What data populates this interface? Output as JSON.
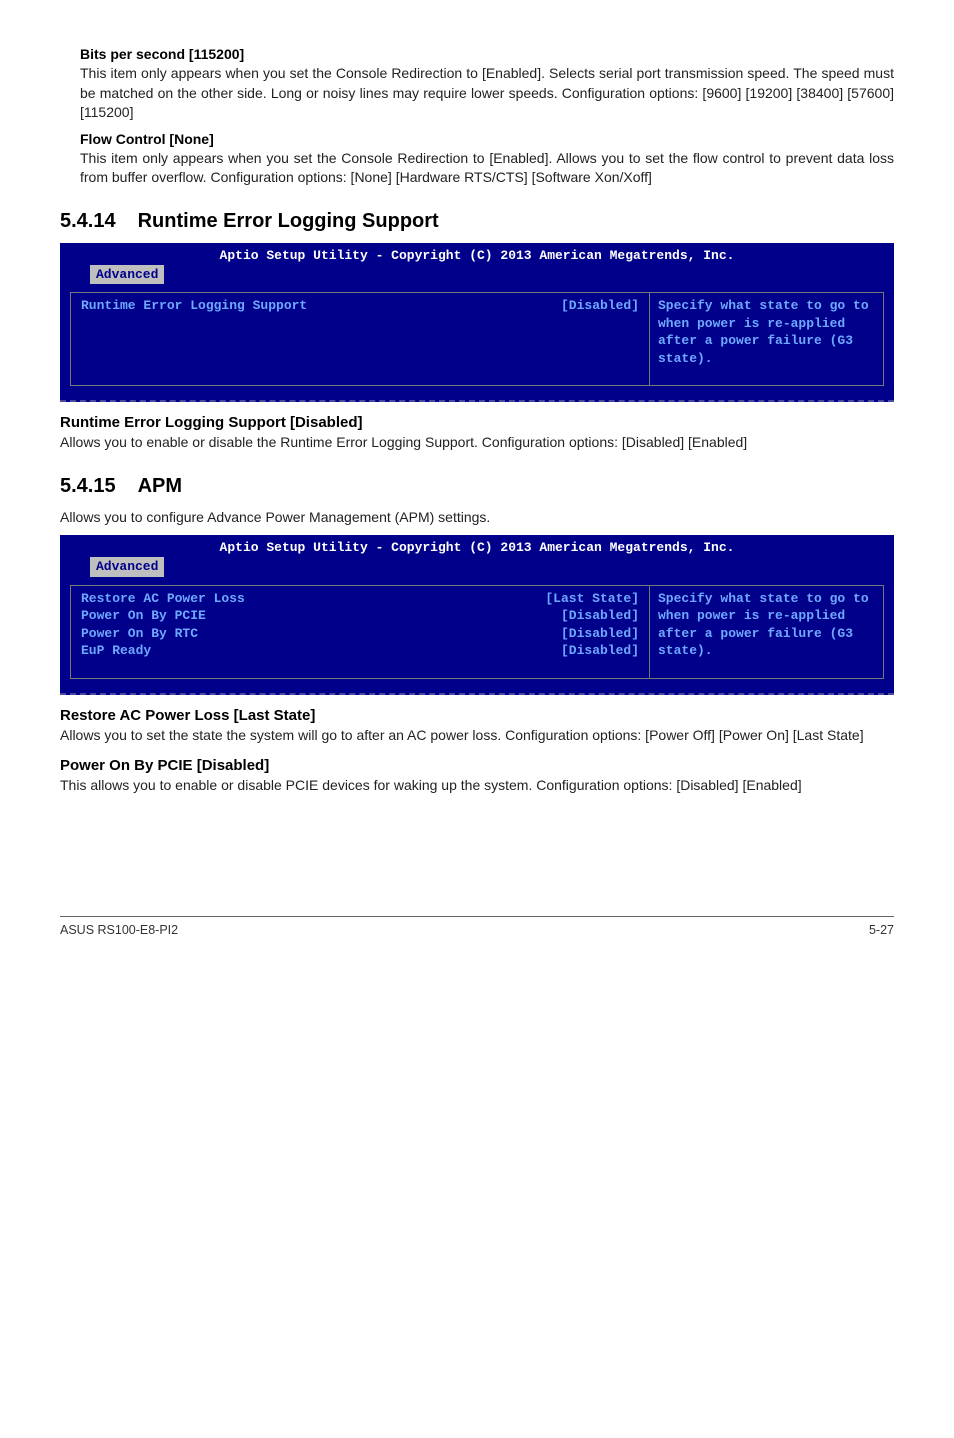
{
  "top": {
    "bits_heading": "Bits per second [115200]",
    "bits_text": "This item only appears when you set the Console Redirection to [Enabled]. Selects serial port transmission speed. The speed must be matched on the other side. Long or noisy lines may require lower speeds. Configuration options: [9600] [19200] [38400] [57600] [115200]",
    "flow_heading": "Flow Control [None]",
    "flow_text": "This item only appears when you set the Console Redirection to [Enabled].  Allows you to set the flow control to prevent data loss from buffer overflow. Configuration options: [None] [Hardware RTS/CTS] [Software Xon/Xoff]"
  },
  "section1": {
    "number": "5.4.14",
    "title": "Runtime Error Logging Support",
    "bios": {
      "header": "Aptio Setup Utility - Copyright (C) 2013 American Megatrends, Inc.",
      "tab": "Advanced",
      "items": [
        {
          "label": "Runtime Error Logging Support",
          "value": "[Disabled]"
        }
      ],
      "help": "Specify what state to go to when power is re-applied after a power failure (G3 state)."
    },
    "sub_heading": "Runtime Error Logging Support [Disabled]",
    "sub_text": "Allows you to enable or disable the Runtime Error Logging Support. Configuration options: [Disabled] [Enabled]"
  },
  "section2": {
    "number": "5.4.15",
    "title": "APM",
    "intro": "Allows you to configure Advance Power Management (APM) settings.",
    "bios": {
      "header": "Aptio Setup Utility - Copyright (C) 2013 American Megatrends, Inc.",
      "tab": "Advanced",
      "items": [
        {
          "label": "Restore AC Power Loss",
          "value": "[Last State]"
        },
        {
          "label": "Power On By PCIE",
          "value": "[Disabled]"
        },
        {
          "label": "Power On By RTC",
          "value": "[Disabled]"
        },
        {
          "label": "EuP Ready",
          "value": "[Disabled]"
        }
      ],
      "help": "Specify what state to go to when power is re-applied after a power failure (G3 state)."
    },
    "restore_heading": "Restore AC Power Loss [Last State]",
    "restore_text": "Allows you to set the state the system will go to after an AC power loss. Configuration options: [Power Off] [Power On] [Last State]",
    "pcie_heading": "Power On By PCIE [Disabled]",
    "pcie_text": "This allows you to enable or disable PCIE devices for waking up the system. Configuration options: [Disabled] [Enabled]"
  },
  "footer": {
    "left": "ASUS RS100-E8-PI2",
    "right": "5-27"
  }
}
